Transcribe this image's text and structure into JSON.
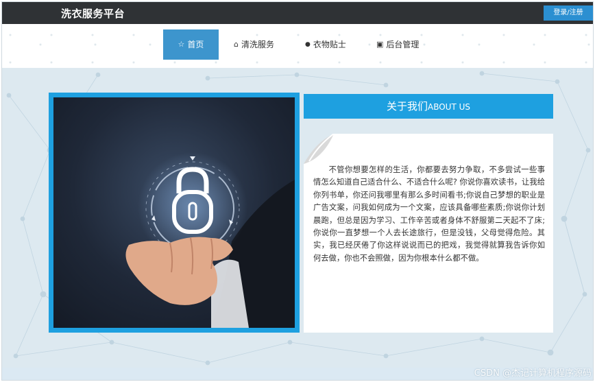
{
  "brand": "洗衣服务平台",
  "login_button": "登录/注册",
  "nav": {
    "items": [
      {
        "icon": "star-icon",
        "glyph": "☆",
        "label": "首页"
      },
      {
        "icon": "basket-icon",
        "glyph": "⌂",
        "label": "清洗服务"
      },
      {
        "icon": "info-icon",
        "glyph": "●",
        "label": "衣物贴士"
      },
      {
        "icon": "dashboard-icon",
        "glyph": "▣",
        "label": "后台管理"
      }
    ],
    "active": "首页"
  },
  "about": {
    "title_cn": "关于我们",
    "title_en": "ABOUT US",
    "text": "不管你想要怎样的生活，你都要去努力争取，不多尝试一些事情怎么知道自己适合什么、不适合什么呢? 你说你喜欢读书，让我给你列书单，你还问我哪里有那么多时间看书;你说自己梦想的职业是广告文案，问我如何成为一个文案，应该具备哪些素质;你说你计划晨跑，但总是因为学习、工作辛苦或者身体不舒服第二天起不了床;你说你一直梦想一个人去长途旅行，但是没钱，父母觉得危险。其实，我已经厌倦了你这样说说而已的把戏，我觉得就算我告诉你如何去做，你也不会照做，因为你根本什么都不做。"
  },
  "watermark": "CSDN @杰记计算机程序源码",
  "colors": {
    "topbar": "#2f3235",
    "accent": "#1ea0e0",
    "nav_active": "#3d95cd",
    "content_bg": "#dde9f0"
  }
}
